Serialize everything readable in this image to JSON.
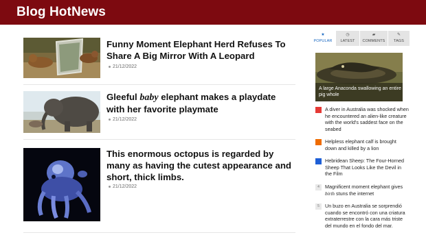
{
  "brand": {
    "title": "Blog HotNews"
  },
  "articles": [
    {
      "title": "Funny Moment Elephant Herd Refuses To Share A Big Mirror With A Leopard",
      "date": "21/12/2022",
      "image": "leopard-mirror-photo"
    },
    {
      "title_before": "Gleeful ",
      "title_em": "baby",
      "title_after": " elephant makes a playdate with her favorite playmate",
      "date": "21/12/2022",
      "image": "baby-elephant-photo"
    },
    {
      "title": "This enormous octopus is regarded by many as having the cutest appearance and short, thick limbs.",
      "date": "21/12/2022",
      "image": "octopus-photo"
    }
  ],
  "tabs": [
    {
      "label": "POPULAR",
      "icon": "star-icon",
      "active": true
    },
    {
      "label": "LATEST",
      "icon": "clock-icon",
      "active": false
    },
    {
      "label": "COMMENTS",
      "icon": "comments-icon",
      "active": false
    },
    {
      "label": "TAGS",
      "icon": "tag-icon",
      "active": false
    }
  ],
  "featured": {
    "caption": "A large Anaconda swallowing an entire pig whole",
    "image": "anaconda-photo"
  },
  "popular": [
    {
      "num": "1",
      "text": "A diver in Australia was shocked when he encountered an alien-like creature with the world's saddest face on the seabed",
      "color": "#e53935"
    },
    {
      "num": "2",
      "text": "Helpless elephant calf is brought down and killed by a lion",
      "color": "#ef6c00"
    },
    {
      "num": "3",
      "text": "Hebridean Sheep: The Four-Horned Sheep That Looks Like the Devil in the Film",
      "color": "#1e5fd6"
    },
    {
      "num": "4",
      "text_before": "Magnificent moment elephant gives ",
      "text_em": "birth",
      "text_after": " stuns the internet",
      "color": "#e8e8e8"
    },
    {
      "num": "5",
      "text": "Un buzo en Australia se sorprendió cuando se encontró con una criatura extraterrestre con la cara más triste del mundo en el fondo del mar.",
      "color": "#e8e8e8"
    }
  ],
  "colors": {
    "header": "#7d0a10",
    "accent": "#1565c0"
  }
}
